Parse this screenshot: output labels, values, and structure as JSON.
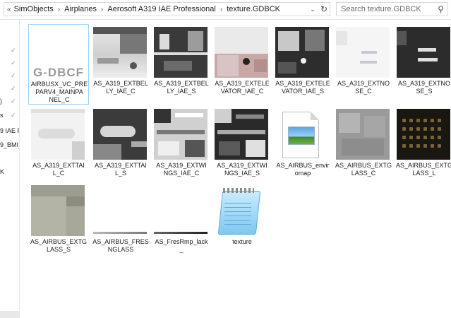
{
  "address": {
    "chevrons": "«",
    "crumbs": [
      "SimObjects",
      "Airplanes",
      "Aerosoft A319 IAE Professional",
      "texture.GDBCK"
    ],
    "separator": "›"
  },
  "search": {
    "placeholder": "Search texture.GDBCK"
  },
  "nav": {
    "rows": [
      {
        "label": ""
      },
      {
        "label": ""
      },
      {
        "label": ""
      },
      {
        "label": ")"
      },
      {
        "label": "s"
      },
      {
        "label": "9 IAE P"
      },
      {
        "label": "9_BMI_"
      },
      {
        "label": ""
      },
      {
        "label": "K"
      }
    ]
  },
  "files": [
    {
      "name": "AIRBUSX_VC_PREPARV4_MAINPANEL_C",
      "label_lines": [
        "AIRBUSX_VC_PRE",
        "PARV4_MAINPA",
        "NEL_C"
      ],
      "thumb": "gdbcf",
      "thumb_text": "G-DBCF",
      "selected": true
    },
    {
      "name": "AS_A319_EXTBELLY_IAE_C",
      "label_lines": [
        "AS_A319_EXTBEL",
        "LY_IAE_C"
      ],
      "thumb": "belly"
    },
    {
      "name": "AS_A319_EXTBELLY_IAE_S",
      "label_lines": [
        "AS_A319_EXTBEL",
        "LY_IAE_S"
      ],
      "thumb": "belly-s"
    },
    {
      "name": "AS_A319_EXTELEVATOR_IAE_C",
      "label_lines": [
        "AS_A319_EXTELE",
        "VATOR_IAE_C"
      ],
      "thumb": "elev-c"
    },
    {
      "name": "AS_A319_EXTELEVATOR_IAE_S",
      "label_lines": [
        "AS_A319_EXTELE",
        "VATOR_IAE_S"
      ],
      "thumb": "elev-s"
    },
    {
      "name": "AS_A319_EXTNOSE_C",
      "label_lines": [
        "AS_A319_EXTNO",
        "SE_C"
      ],
      "thumb": "nose-c"
    },
    {
      "name": "AS_A319_EXTNOSE_S",
      "label_lines": [
        "AS_A319_EXTNO",
        "SE_S"
      ],
      "thumb": "nose-s"
    },
    {
      "name": "AS_A319_EXTTAIL_C",
      "label_lines": [
        "AS_A319_EXTTAI",
        "L_C"
      ],
      "thumb": "tail-c"
    },
    {
      "name": "AS_A319_EXTTAIL_S",
      "label_lines": [
        "AS_A319_EXTTAI",
        "L_S"
      ],
      "thumb": "tail-s"
    },
    {
      "name": "AS_A319_EXTWINGS_IAE_C",
      "label_lines": [
        "AS_A319_EXTWI",
        "NGS_IAE_C"
      ],
      "thumb": "wing-c"
    },
    {
      "name": "AS_A319_EXTWINGS_IAE_S",
      "label_lines": [
        "AS_A319_EXTWI",
        "NGS_IAE_S"
      ],
      "thumb": "wing-s"
    },
    {
      "name": "AS_AIRBUS_envir omap",
      "label_lines": [
        "AS_AIRBUS_envir",
        "omap"
      ],
      "thumb": "imgfile"
    },
    {
      "name": "AS_AIRBUS_EXTGLASS_C",
      "label_lines": [
        "AS_AIRBUS_EXTG",
        "LASS_C"
      ],
      "thumb": "glass-c"
    },
    {
      "name": "AS_AIRBUS_EXTGLASS_L",
      "label_lines": [
        "AS_AIRBUS_EXTG",
        "LASS_L"
      ],
      "thumb": "glass-l"
    },
    {
      "name": "AS_AIRBUS_EXTGLASS_S",
      "label_lines": [
        "AS_AIRBUS_EXTG",
        "LASS_S"
      ],
      "thumb": "glass-s"
    },
    {
      "name": "AS_AIRBUS_FRESNGLASS",
      "label_lines": [
        "AS_AIRBUS_FRES",
        "NGLASS"
      ],
      "thumb": "fres"
    },
    {
      "name": "AS_FresRmp_lack_",
      "label_lines": [
        "AS_FresRmp_lack",
        "_"
      ],
      "thumb": "fresrmp"
    },
    {
      "name": "texture",
      "label_lines": [
        "texture"
      ],
      "thumb": "notepad"
    }
  ]
}
